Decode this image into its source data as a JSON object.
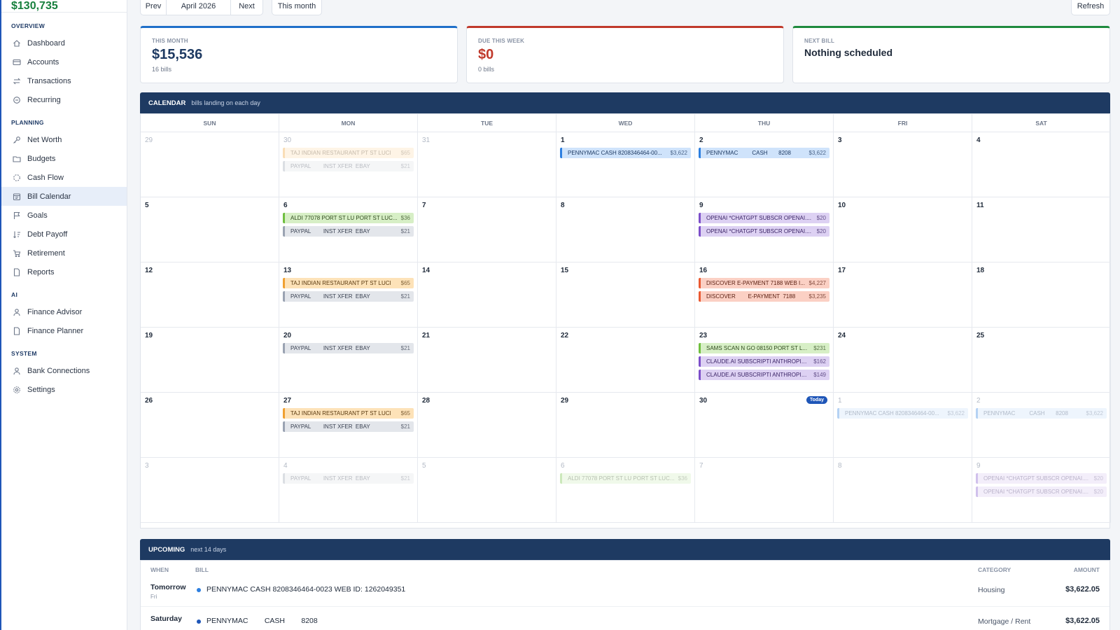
{
  "sidebar": {
    "net_worth": "$130,735",
    "sections": [
      {
        "title": "OVERVIEW",
        "items": [
          {
            "label": "Dashboard",
            "icon": "home-icon"
          },
          {
            "label": "Accounts",
            "icon": "credit-card-icon"
          },
          {
            "label": "Transactions",
            "icon": "arrows-exchange-icon"
          },
          {
            "label": "Recurring",
            "icon": "chat-bubble-icon"
          }
        ]
      },
      {
        "title": "PLANNING",
        "items": [
          {
            "label": "Net Worth",
            "icon": "key-icon"
          },
          {
            "label": "Budgets",
            "icon": "folder-icon"
          },
          {
            "label": "Cash Flow",
            "icon": "loader-icon"
          },
          {
            "label": "Bill Calendar",
            "icon": "calendar-icon",
            "active": true
          },
          {
            "label": "Goals",
            "icon": "flag-icon"
          },
          {
            "label": "Debt Payoff",
            "icon": "sort-icon"
          },
          {
            "label": "Retirement",
            "icon": "cart-icon"
          },
          {
            "label": "Reports",
            "icon": "document-icon"
          }
        ]
      },
      {
        "title": "AI",
        "items": [
          {
            "label": "Finance Advisor",
            "icon": "user-icon"
          },
          {
            "label": "Finance Planner",
            "icon": "document-icon"
          }
        ]
      },
      {
        "title": "SYSTEM",
        "items": [
          {
            "label": "Bank Connections",
            "icon": "user-icon"
          },
          {
            "label": "Settings",
            "icon": "gear-icon"
          }
        ]
      }
    ]
  },
  "toolbar": {
    "prev": "Prev",
    "month": "April 2026",
    "next": "Next",
    "this_month": "This month",
    "refresh": "Refresh"
  },
  "cards": [
    {
      "label": "THIS MONTH",
      "value": "$15,536",
      "sub": "16 bills",
      "accent": "#1f6fc9",
      "value_color": "#1e3a62"
    },
    {
      "label": "DUE THIS WEEK",
      "value": "$0",
      "sub": "0 bills",
      "accent": "#c0392b",
      "value_color": "#c0392b"
    },
    {
      "label": "NEXT BILL",
      "value": "Nothing scheduled",
      "sub": "",
      "accent": "#1e8a3e",
      "value_color": "#1f2a3a"
    }
  ],
  "calendar": {
    "title": "CALENDAR",
    "subtitle": "bills landing on each day",
    "today_label": "Today",
    "weekdays": [
      "SUN",
      "MON",
      "TUE",
      "WED",
      "THU",
      "FRI",
      "SAT"
    ],
    "weeks": [
      [
        {
          "d": "29",
          "other": true,
          "bills": []
        },
        {
          "d": "30",
          "other": true,
          "bills": [
            {
              "n": "TAJ INDIAN RESTAURANT PT ST LUCI",
              "a": "$65",
              "c": "orange"
            },
            {
              "n": "PAYPAL        INST XFER  EBAY",
              "a": "$21",
              "c": "gray"
            }
          ]
        },
        {
          "d": "31",
          "other": true,
          "bills": []
        },
        {
          "d": "1",
          "bills": [
            {
              "n": "PENNYMAC CASH 8208346464-00...",
              "a": "$3,622",
              "c": "blue"
            }
          ]
        },
        {
          "d": "2",
          "bills": [
            {
              "n": "PENNYMAC         CASH       8208",
              "a": "$3,622",
              "c": "blue"
            }
          ]
        },
        {
          "d": "3",
          "bills": []
        },
        {
          "d": "4",
          "bills": []
        }
      ],
      [
        {
          "d": "5",
          "bills": []
        },
        {
          "d": "6",
          "bills": [
            {
              "n": "ALDI 77078 PORT ST LU PORT ST LUC...",
              "a": "$36",
              "c": "green"
            },
            {
              "n": "PAYPAL        INST XFER  EBAY",
              "a": "$21",
              "c": "gray"
            }
          ]
        },
        {
          "d": "7",
          "bills": []
        },
        {
          "d": "8",
          "bills": []
        },
        {
          "d": "9",
          "bills": [
            {
              "n": "OPENAI *CHATGPT SUBSCR OPENAI....",
              "a": "$20",
              "c": "purple"
            },
            {
              "n": "OPENAI *CHATGPT SUBSCR OPENAI....",
              "a": "$20",
              "c": "purple"
            }
          ]
        },
        {
          "d": "10",
          "bills": []
        },
        {
          "d": "11",
          "bills": []
        }
      ],
      [
        {
          "d": "12",
          "bills": []
        },
        {
          "d": "13",
          "bills": [
            {
              "n": "TAJ INDIAN RESTAURANT PT ST LUCI",
              "a": "$65",
              "c": "orange"
            },
            {
              "n": "PAYPAL        INST XFER  EBAY",
              "a": "$21",
              "c": "gray"
            }
          ]
        },
        {
          "d": "14",
          "bills": []
        },
        {
          "d": "15",
          "bills": []
        },
        {
          "d": "16",
          "bills": [
            {
              "n": "DISCOVER E-PAYMENT 7188 WEB I...",
              "a": "$4,227",
              "c": "red"
            },
            {
              "n": "DISCOVER        E-PAYMENT  7188",
              "a": "$3,235",
              "c": "red"
            }
          ]
        },
        {
          "d": "17",
          "bills": []
        },
        {
          "d": "18",
          "bills": []
        }
      ],
      [
        {
          "d": "19",
          "bills": []
        },
        {
          "d": "20",
          "bills": [
            {
              "n": "PAYPAL        INST XFER  EBAY",
              "a": "$21",
              "c": "gray"
            }
          ]
        },
        {
          "d": "21",
          "bills": []
        },
        {
          "d": "22",
          "bills": []
        },
        {
          "d": "23",
          "bills": [
            {
              "n": "SAMS SCAN N GO 08150 PORT ST L...",
              "a": "$231",
              "c": "green"
            },
            {
              "n": "CLAUDE.AI SUBSCRIPTI ANTHROPIC....",
              "a": "$162",
              "c": "purple"
            },
            {
              "n": "CLAUDE.AI SUBSCRIPTI ANTHROPIC.C",
              "a": "$149",
              "c": "purple"
            }
          ]
        },
        {
          "d": "24",
          "bills": []
        },
        {
          "d": "25",
          "bills": []
        }
      ],
      [
        {
          "d": "26",
          "bills": []
        },
        {
          "d": "27",
          "bills": [
            {
              "n": "TAJ INDIAN RESTAURANT PT ST LUCI",
              "a": "$65",
              "c": "orange"
            },
            {
              "n": "PAYPAL        INST XFER  EBAY",
              "a": "$21",
              "c": "gray"
            }
          ]
        },
        {
          "d": "28",
          "bills": []
        },
        {
          "d": "29",
          "bills": []
        },
        {
          "d": "30",
          "today": true,
          "bills": []
        },
        {
          "d": "1",
          "other": true,
          "bills": [
            {
              "n": "PENNYMAC CASH 8208346464-00...",
              "a": "$3,622",
              "c": "blue"
            }
          ]
        },
        {
          "d": "2",
          "other": true,
          "bills": [
            {
              "n": "PENNYMAC         CASH       8208",
              "a": "$3,622",
              "c": "blue"
            }
          ]
        }
      ],
      [
        {
          "d": "3",
          "other": true,
          "bills": []
        },
        {
          "d": "4",
          "other": true,
          "bills": [
            {
              "n": "PAYPAL        INST XFER  EBAY",
              "a": "$21",
              "c": "gray"
            }
          ]
        },
        {
          "d": "5",
          "other": true,
          "bills": []
        },
        {
          "d": "6",
          "other": true,
          "bills": [
            {
              "n": "ALDI 77078 PORT ST LU PORT ST LUC...",
              "a": "$36",
              "c": "green"
            }
          ]
        },
        {
          "d": "7",
          "other": true,
          "bills": []
        },
        {
          "d": "8",
          "other": true,
          "bills": []
        },
        {
          "d": "9",
          "other": true,
          "bills": [
            {
              "n": "OPENAI *CHATGPT SUBSCR OPENAI....",
              "a": "$20",
              "c": "purple"
            },
            {
              "n": "OPENAI *CHATGPT SUBSCR OPENAI....",
              "a": "$20",
              "c": "purple"
            }
          ]
        }
      ]
    ],
    "colors": {
      "blue": {
        "bg": "#cfe3fb",
        "bar": "#2d7fe0",
        "text": "#1e3a62"
      },
      "orange": {
        "bg": "#fde2b8",
        "bar": "#f0a030",
        "text": "#5a3a10"
      },
      "gray": {
        "bg": "#e3e6eb",
        "bar": "#9aa3b2",
        "text": "#3a4252"
      },
      "green": {
        "bg": "#d7efc6",
        "bar": "#6fbf3f",
        "text": "#2f4a1d"
      },
      "purple": {
        "bg": "#ddd1f3",
        "bar": "#7c4fc9",
        "text": "#3a2466"
      },
      "red": {
        "bg": "#fbd0c4",
        "bar": "#ea5a32",
        "text": "#5a1e10"
      }
    }
  },
  "upcoming": {
    "title": "UPCOMING",
    "subtitle": "next 14 days",
    "headers": {
      "when": "WHEN",
      "bill": "BILL",
      "category": "CATEGORY",
      "amount": "AMOUNT"
    },
    "rows": [
      {
        "when": "Tomorrow",
        "sub": "Fri",
        "bill": "PENNYMAC CASH 8208346464-0023 WEB ID: 1262049351",
        "category": "Housing",
        "amount": "$3,622.05",
        "dot": "#2d7fe0"
      },
      {
        "when": "Saturday",
        "sub": "",
        "bill": "PENNYMAC        CASH        8208",
        "category": "Mortgage / Rent",
        "amount": "$3,622.05",
        "dot": "#1f56b8"
      }
    ]
  }
}
